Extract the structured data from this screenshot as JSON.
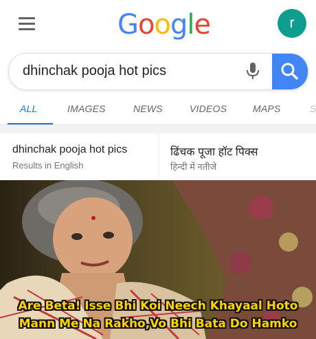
{
  "header": {
    "logo_letters": [
      {
        "char": "G",
        "color": "#4285F4"
      },
      {
        "char": "o",
        "color": "#EA4335"
      },
      {
        "char": "o",
        "color": "#FBBC05"
      },
      {
        "char": "g",
        "color": "#4285F4"
      },
      {
        "char": "l",
        "color": "#34A853"
      },
      {
        "char": "e",
        "color": "#EA4335"
      }
    ],
    "avatar_letter": "r",
    "avatar_color": "#0f9d8f",
    "menu_icon": "hamburger-menu-icon"
  },
  "search": {
    "query": "dhinchak pooja hot pics",
    "mic_icon": "microphone-icon",
    "search_icon": "magnifier-icon",
    "button_color": "#4285f4"
  },
  "tabs": [
    {
      "label": "ALL",
      "active": true
    },
    {
      "label": "IMAGES",
      "active": false
    },
    {
      "label": "NEWS",
      "active": false
    },
    {
      "label": "VIDEOS",
      "active": false
    },
    {
      "label": "MAPS",
      "active": false
    },
    {
      "label": "S",
      "active": false
    }
  ],
  "language_options": [
    {
      "query": "dhinchak pooja hot pics",
      "subtitle": "Results in English"
    },
    {
      "query": "ढिंचक पूजा हॉट पिक्स",
      "subtitle": "हिन्दी में नतीजे"
    }
  ],
  "image_caption": {
    "line1": "Are Beta! Isse Bhi Koi Neech Khayaal Hoto",
    "line2": "Mann Me Na Rakho,Vo Bhi Bata Do Hamko",
    "color": "#ffd400"
  }
}
